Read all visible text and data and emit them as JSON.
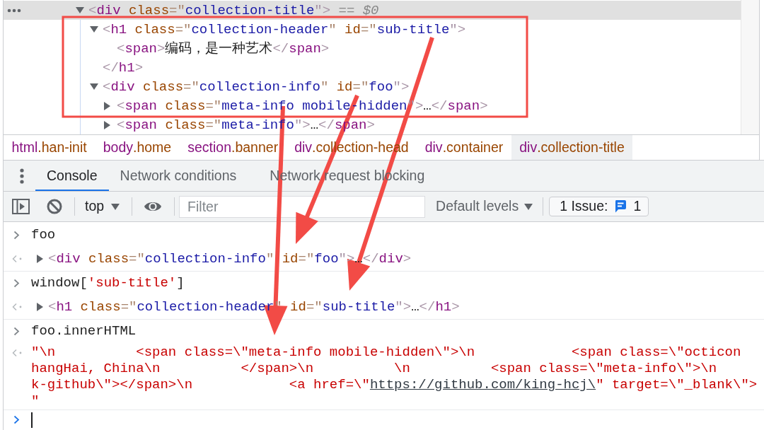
{
  "elements_tree": [
    {
      "selected": true,
      "expanded": true,
      "tokens": [
        {
          "kind": "bracket",
          "text": "<"
        },
        {
          "kind": "tag",
          "text": "div"
        },
        {
          "kind": "attr",
          "text": " class"
        },
        {
          "kind": "punct",
          "text": "=\""
        },
        {
          "kind": "value",
          "text": "collection-title"
        },
        {
          "kind": "bracket",
          "text": "\">"
        },
        {
          "kind": "hint",
          "text": " == "
        },
        {
          "kind": "var",
          "text": "$0"
        }
      ],
      "children": [
        {
          "selected": false,
          "expanded": true,
          "tokens": [
            {
              "kind": "bracket",
              "text": "<"
            },
            {
              "kind": "tag",
              "text": "h1"
            },
            {
              "kind": "attr",
              "text": " class"
            },
            {
              "kind": "punct",
              "text": "=\""
            },
            {
              "kind": "value",
              "text": "collection-header"
            },
            {
              "kind": "punct",
              "text": "\""
            },
            {
              "kind": "attr",
              "text": " id"
            },
            {
              "kind": "punct",
              "text": "=\""
            },
            {
              "kind": "value",
              "text": "sub-title"
            },
            {
              "kind": "bracket",
              "text": "\">"
            }
          ],
          "children": [
            {
              "selected": false,
              "tokens": [
                {
                  "kind": "bracket",
                  "text": "<"
                },
                {
                  "kind": "tag",
                  "text": "span"
                },
                {
                  "kind": "bracket",
                  "text": ">"
                },
                {
                  "kind": "text",
                  "text": "编码，是一种艺术"
                },
                {
                  "kind": "bracket",
                  "text": "</"
                },
                {
                  "kind": "tag",
                  "text": "span"
                },
                {
                  "kind": "bracket",
                  "text": ">"
                }
              ]
            }
          ],
          "closing": [
            {
              "kind": "bracket",
              "text": "</"
            },
            {
              "kind": "tag",
              "text": "h1"
            },
            {
              "kind": "bracket",
              "text": ">"
            }
          ]
        },
        {
          "selected": false,
          "expanded": true,
          "tokens": [
            {
              "kind": "bracket",
              "text": "<"
            },
            {
              "kind": "tag",
              "text": "div"
            },
            {
              "kind": "attr",
              "text": " class"
            },
            {
              "kind": "punct",
              "text": "=\""
            },
            {
              "kind": "value",
              "text": "collection-info"
            },
            {
              "kind": "punct",
              "text": "\""
            },
            {
              "kind": "attr",
              "text": " id"
            },
            {
              "kind": "punct",
              "text": "=\""
            },
            {
              "kind": "value",
              "text": "foo"
            },
            {
              "kind": "bracket",
              "text": "\">"
            }
          ],
          "children": [
            {
              "selected": false,
              "expanded": false,
              "tokens": [
                {
                  "kind": "bracket",
                  "text": "<"
                },
                {
                  "kind": "tag",
                  "text": "span"
                },
                {
                  "kind": "attr",
                  "text": " class"
                },
                {
                  "kind": "punct",
                  "text": "=\""
                },
                {
                  "kind": "value",
                  "text": "meta-info mobile-hidden"
                },
                {
                  "kind": "bracket",
                  "text": "\">"
                },
                {
                  "kind": "text",
                  "text": "…"
                },
                {
                  "kind": "bracket",
                  "text": "</"
                },
                {
                  "kind": "tag",
                  "text": "span"
                },
                {
                  "kind": "bracket",
                  "text": ">"
                }
              ]
            },
            {
              "selected": false,
              "expanded": false,
              "tokens": [
                {
                  "kind": "bracket",
                  "text": "<"
                },
                {
                  "kind": "tag",
                  "text": "span"
                },
                {
                  "kind": "attr",
                  "text": " class"
                },
                {
                  "kind": "punct",
                  "text": "=\""
                },
                {
                  "kind": "value",
                  "text": "meta-info"
                },
                {
                  "kind": "bracket",
                  "text": "\">"
                },
                {
                  "kind": "text",
                  "text": "…"
                },
                {
                  "kind": "bracket",
                  "text": "</"
                },
                {
                  "kind": "tag",
                  "text": "span"
                },
                {
                  "kind": "bracket",
                  "text": ">"
                }
              ]
            }
          ]
        }
      ]
    }
  ],
  "breadcrumbs": [
    {
      "tag": "html",
      "class": ".han-init",
      "selected": false
    },
    {
      "tag": "body",
      "class": ".home",
      "selected": false
    },
    {
      "tag": "section",
      "class": ".banner",
      "selected": false
    },
    {
      "tag": "div",
      "class": ".collection-head",
      "selected": false
    },
    {
      "tag": "div",
      "class": ".container",
      "selected": false
    },
    {
      "tag": "div",
      "class": ".collection-title",
      "selected": true
    }
  ],
  "drawer_tabs": [
    {
      "label": "Console",
      "selected": true
    },
    {
      "label": "Network conditions",
      "selected": false
    },
    {
      "label": "Network request blocking",
      "selected": false
    }
  ],
  "console_toolbar": {
    "context": "top",
    "filter": {
      "placeholder": "Filter"
    },
    "levels": "Default levels",
    "issues": {
      "label": "1 Issue:",
      "count": "1"
    }
  },
  "console_messages": [
    {
      "command": [
        {
          "kind": "code",
          "text": "foo"
        }
      ],
      "result": {
        "kind": "node",
        "expanded": false,
        "tokens": [
          {
            "kind": "bracket",
            "text": "<"
          },
          {
            "kind": "tag",
            "text": "div"
          },
          {
            "kind": "attr",
            "text": " class"
          },
          {
            "kind": "punct",
            "text": "=\""
          },
          {
            "kind": "value",
            "text": "collection-info"
          },
          {
            "kind": "punct",
            "text": "\""
          },
          {
            "kind": "attr",
            "text": " id"
          },
          {
            "kind": "punct",
            "text": "=\""
          },
          {
            "kind": "value",
            "text": "foo"
          },
          {
            "kind": "bracket",
            "text": "\">"
          },
          {
            "kind": "text",
            "text": "…"
          },
          {
            "kind": "bracket",
            "text": "</"
          },
          {
            "kind": "tag",
            "text": "div"
          },
          {
            "kind": "bracket",
            "text": ">"
          }
        ]
      }
    },
    {
      "command": [
        {
          "kind": "code",
          "text": "window["
        },
        {
          "kind": "string",
          "text": "'sub-title'"
        },
        {
          "kind": "code",
          "text": "]"
        }
      ],
      "result": {
        "kind": "node",
        "expanded": false,
        "tokens": [
          {
            "kind": "bracket",
            "text": "<"
          },
          {
            "kind": "tag",
            "text": "h1"
          },
          {
            "kind": "attr",
            "text": " class"
          },
          {
            "kind": "punct",
            "text": "=\""
          },
          {
            "kind": "value",
            "text": "collection-header"
          },
          {
            "kind": "punct",
            "text": "\""
          },
          {
            "kind": "attr",
            "text": " id"
          },
          {
            "kind": "punct",
            "text": "=\""
          },
          {
            "kind": "value",
            "text": "sub-title"
          },
          {
            "kind": "bracket",
            "text": "\">"
          },
          {
            "kind": "text",
            "text": "…"
          },
          {
            "kind": "bracket",
            "text": "</"
          },
          {
            "kind": "tag",
            "text": "h1"
          },
          {
            "kind": "bracket",
            "text": ">"
          }
        ]
      }
    },
    {
      "command": [
        {
          "kind": "code",
          "text": "foo.innerHTML"
        }
      ],
      "result": {
        "kind": "string",
        "lines": [
          {
            "segments": [
              {
                "kind": "string",
                "text": "\"\\n          <span class=\\\"meta-info mobile-hidden\\\">\\n            <span class=\\\"octicon"
              }
            ]
          },
          {
            "segments": [
              {
                "kind": "string",
                "text": "hangHai, China\\n          </span>\\n          \\n          <span class=\\\"meta-info\\\">\\n"
              }
            ]
          },
          {
            "segments": [
              {
                "kind": "string",
                "text": "k-github\\\"></span>\\n            <a href=\\\""
              },
              {
                "kind": "link",
                "text": "https://github.com/king-hcj\\"
              },
              {
                "kind": "string",
                "text": "\" target=\\\"_blank\\\">"
              }
            ]
          },
          {
            "segments": [
              {
                "kind": "string",
                "text": "\""
              }
            ]
          }
        ]
      }
    }
  ],
  "console_prompt": {
    "focused": true
  },
  "annotations": [
    {
      "kind": "box"
    },
    {
      "kind": "arrow"
    },
    {
      "kind": "arrow"
    },
    {
      "kind": "arrow"
    }
  ]
}
